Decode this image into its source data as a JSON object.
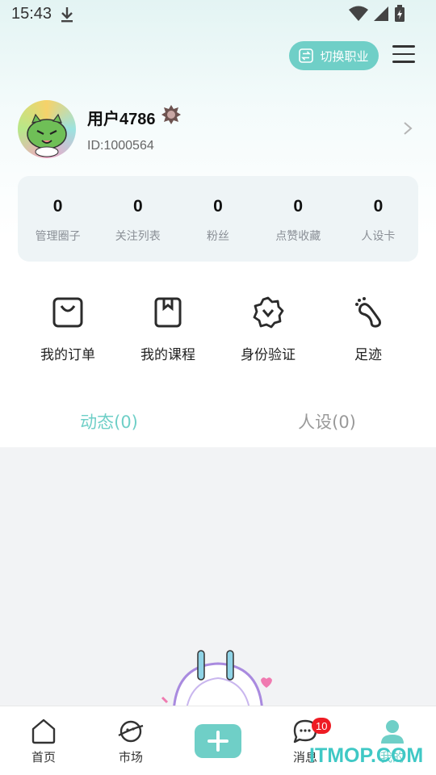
{
  "status_bar": {
    "time": "15:43",
    "icons": [
      "download-icon",
      "wifi-icon",
      "signal-icon",
      "battery-charging-icon"
    ]
  },
  "header": {
    "switch_role_label": "切换职业",
    "menu_icon": "hamburger-menu-icon"
  },
  "profile": {
    "username": "用户4786",
    "user_id": "ID:1000564",
    "avatar_icon": "dragon-avatar",
    "badge_icon": "level-badge-icon"
  },
  "stats": [
    {
      "value": "0",
      "label": "管理圈子"
    },
    {
      "value": "0",
      "label": "关注列表"
    },
    {
      "value": "0",
      "label": "粉丝"
    },
    {
      "value": "0",
      "label": "点赞收藏"
    },
    {
      "value": "0",
      "label": "人设卡"
    }
  ],
  "quick_links": [
    {
      "label": "我的订单",
      "icon": "shopping-bag-icon"
    },
    {
      "label": "我的课程",
      "icon": "book-icon"
    },
    {
      "label": "身份验证",
      "icon": "verified-badge-icon"
    },
    {
      "label": "足迹",
      "icon": "footprint-icon"
    }
  ],
  "tabs": [
    {
      "label": "动态(0)",
      "active": true
    },
    {
      "label": "人设(0)",
      "active": false
    }
  ],
  "bottom_nav": [
    {
      "label": "首页",
      "icon": "home-icon"
    },
    {
      "label": "市场",
      "icon": "planet-icon"
    },
    {
      "label": "",
      "icon": "plus-icon"
    },
    {
      "label": "消息",
      "icon": "chat-bubble-icon",
      "badge": "10"
    },
    {
      "label": "我的",
      "icon": "user-icon",
      "active": true
    }
  ],
  "watermark": "ITMOP.COM",
  "colors": {
    "accent": "#6fcfc7",
    "badge": "#ee1c24",
    "background": "#f2f3f5"
  }
}
